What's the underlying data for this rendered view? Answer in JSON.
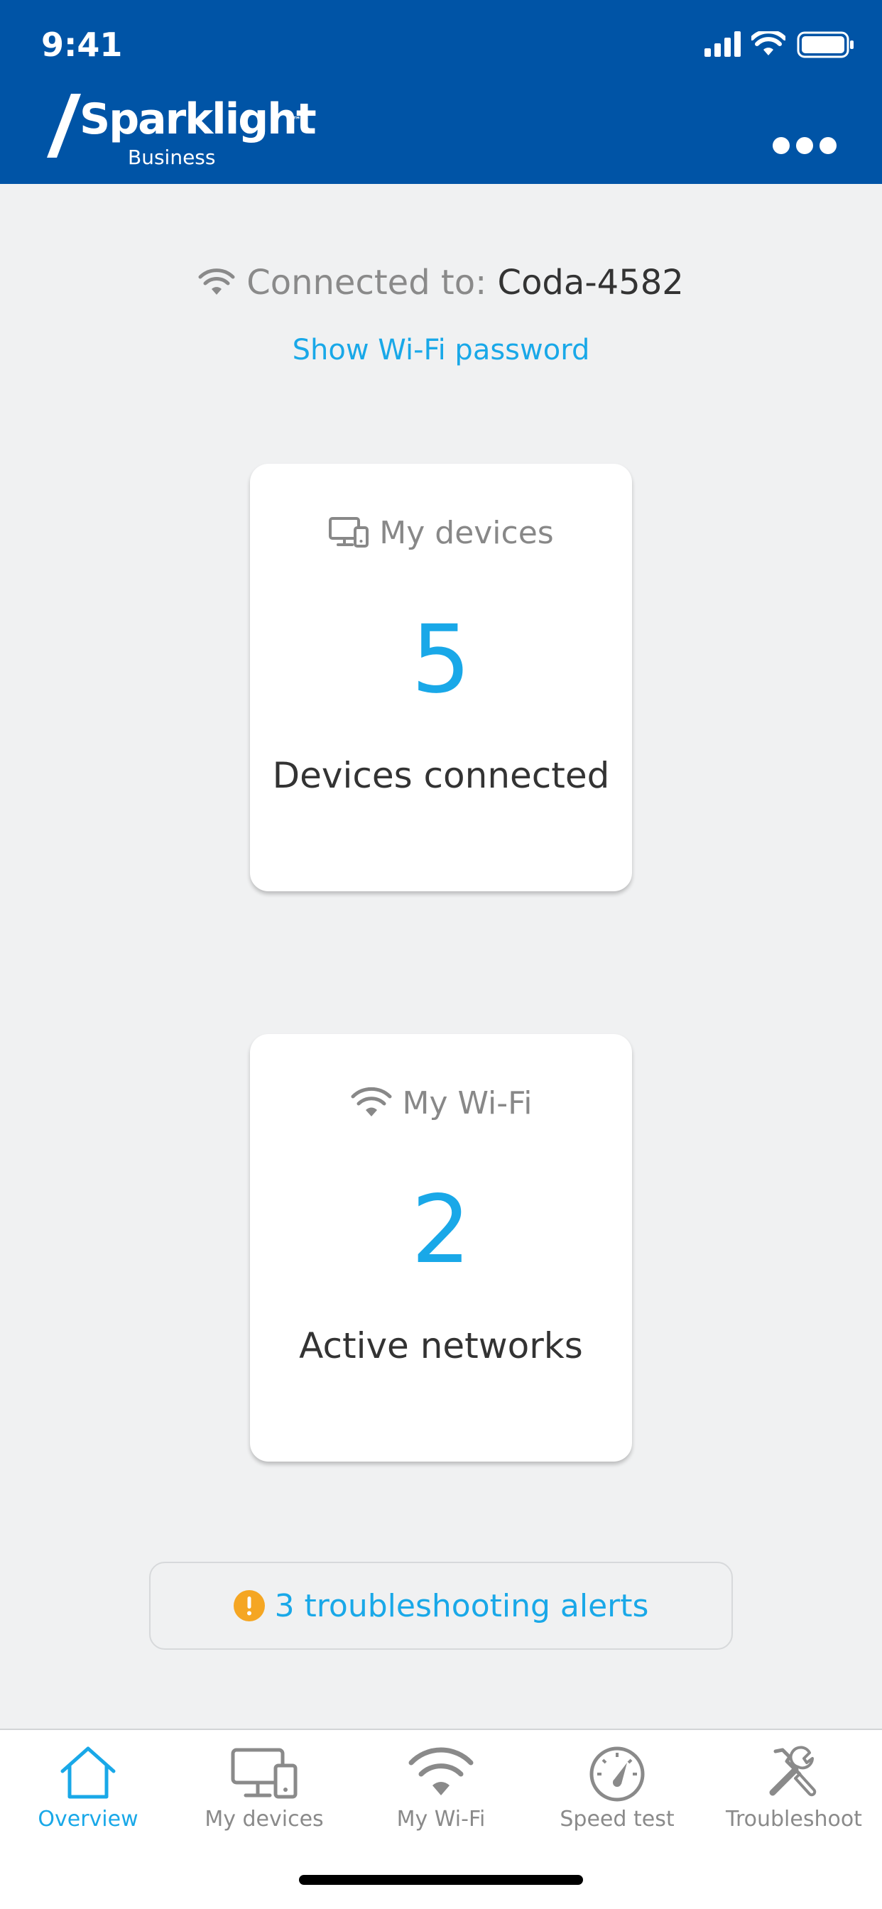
{
  "status_bar": {
    "time": "9:41"
  },
  "header": {
    "brand": "Sparklight",
    "brand_tm": "™",
    "brand_sub": "Business"
  },
  "connection": {
    "label": "Connected to:",
    "network": "Coda-4582",
    "show_password": "Show Wi-Fi password"
  },
  "cards": [
    {
      "title": "My devices",
      "icon": "devices-icon",
      "value": "5",
      "caption": "Devices connected"
    },
    {
      "title": "My Wi-Fi",
      "icon": "wifi-icon",
      "value": "2",
      "caption": "Active networks"
    }
  ],
  "alerts": {
    "text": "3 troubleshooting alerts"
  },
  "tabs": [
    {
      "label": "Overview",
      "icon": "home-icon",
      "active": true
    },
    {
      "label": "My devices",
      "icon": "devices-icon",
      "active": false
    },
    {
      "label": "My Wi-Fi",
      "icon": "wifi-icon",
      "active": false
    },
    {
      "label": "Speed test",
      "icon": "speedometer-icon",
      "active": false
    },
    {
      "label": "Troubleshoot",
      "icon": "tools-icon",
      "active": false
    }
  ],
  "colors": {
    "header_bg": "#0054a6",
    "accent": "#19a8e8",
    "alert": "#f5a623",
    "page_bg": "#f0f1f2"
  }
}
